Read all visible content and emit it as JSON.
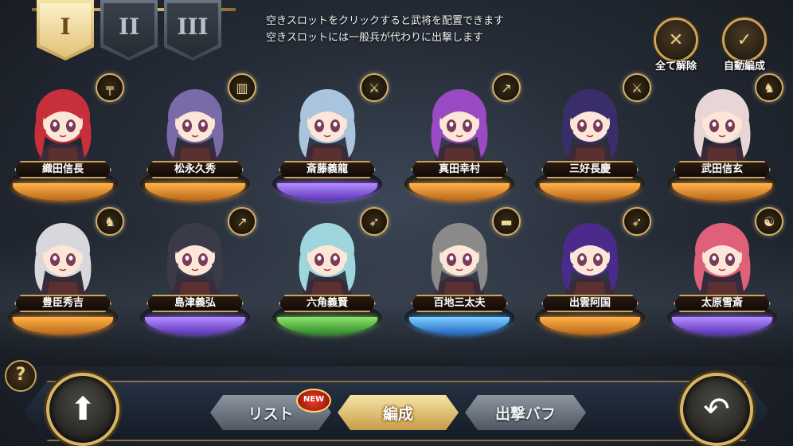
{
  "tabs": [
    {
      "label": "I",
      "active": true
    },
    {
      "label": "II",
      "active": false
    },
    {
      "label": "III",
      "active": false
    }
  ],
  "info": {
    "line1": "空きスロットをクリックすると武将を配置できます",
    "line2": "空きスロットには一般兵が代わりに出撃します"
  },
  "actions": {
    "clear_all": "全て解除",
    "auto_form": "自動編成"
  },
  "units": [
    {
      "name": "織田信長",
      "ring": "orange",
      "weapon_icon": "gun-icon",
      "hair": "#c7303a"
    },
    {
      "name": "松永久秀",
      "ring": "orange",
      "weapon_icon": "shield-icon",
      "hair": "#7b6aa8"
    },
    {
      "name": "斎藤義龍",
      "ring": "purple",
      "weapon_icon": "sword-icon",
      "hair": "#a9c4dc"
    },
    {
      "name": "真田幸村",
      "ring": "orange",
      "weapon_icon": "spear-icon",
      "hair": "#9a4ac2"
    },
    {
      "name": "三好長慶",
      "ring": "orange",
      "weapon_icon": "sword-icon",
      "hair": "#3a2e6a"
    },
    {
      "name": "武田信玄",
      "ring": "orange",
      "weapon_icon": "horse-icon",
      "hair": "#e8d6d6"
    },
    {
      "name": "豊臣秀吉",
      "ring": "orange",
      "weapon_icon": "horse-icon",
      "hair": "#d8d8dc"
    },
    {
      "name": "島津義弘",
      "ring": "purple",
      "weapon_icon": "spear-icon",
      "hair": "#3b3a48"
    },
    {
      "name": "六角義賢",
      "ring": "green",
      "weapon_icon": "bow-icon",
      "hair": "#9fd6dd"
    },
    {
      "name": "百地三太夫",
      "ring": "blue",
      "weapon_icon": "cannon-icon",
      "hair": "#8a8a8a"
    },
    {
      "name": "出雲阿国",
      "ring": "orange",
      "weapon_icon": "bow-icon",
      "hair": "#4a2a8a"
    },
    {
      "name": "太原雪斎",
      "ring": "purple",
      "weapon_icon": "yin-yang-icon",
      "hair": "#e0607a"
    }
  ],
  "bottom": {
    "list_label": "リスト",
    "new_badge": "NEW",
    "formation_label": "編成",
    "buff_label": "出撃バフ",
    "help_label": "?"
  }
}
